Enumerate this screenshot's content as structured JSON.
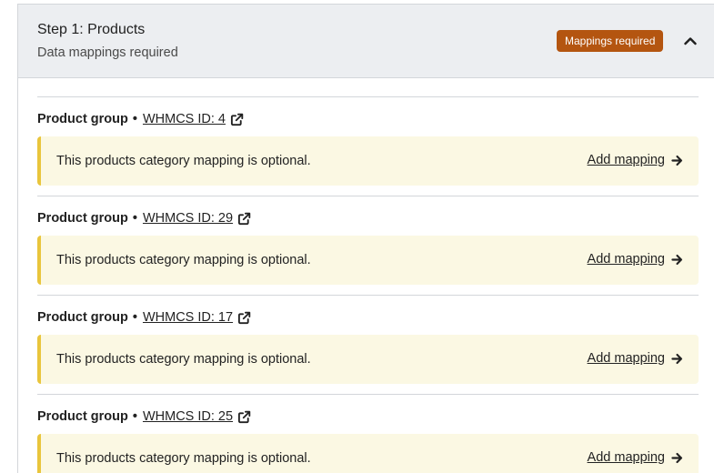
{
  "step": {
    "title": "Step 1: Products",
    "subtitle": "Data mappings required",
    "badge": "Mappings required",
    "collapse_icon": "chevron-up-icon"
  },
  "colors": {
    "header_bg": "#eceef1",
    "badge_bg": "#b45510",
    "notice_bg": "#fbf8e3",
    "notice_border": "#e9c53c"
  },
  "groups": [
    {
      "label": "Product group",
      "separator": "•",
      "id_text": "WHMCS ID: 4",
      "notice": "This products category mapping is optional.",
      "action": "Add mapping"
    },
    {
      "label": "Product group",
      "separator": "•",
      "id_text": "WHMCS ID: 29",
      "notice": "This products category mapping is optional.",
      "action": "Add mapping"
    },
    {
      "label": "Product group",
      "separator": "•",
      "id_text": "WHMCS ID: 17",
      "notice": "This products category mapping is optional.",
      "action": "Add mapping"
    },
    {
      "label": "Product group",
      "separator": "•",
      "id_text": "WHMCS ID: 25",
      "notice": "This products category mapping is optional.",
      "action": "Add mapping"
    }
  ]
}
